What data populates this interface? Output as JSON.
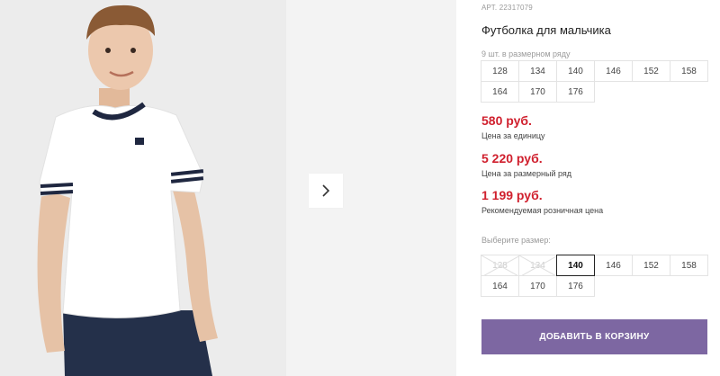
{
  "gallery": {
    "main_photo_icon": "boy-in-white-tshirt-photo",
    "next_icon": "chevron-right-icon"
  },
  "product": {
    "art_label": "АРТ. 22317079",
    "title": "Футболка для мальчика",
    "pack_label": "9 шт. в размерном ряду",
    "pack_sizes": [
      "128",
      "134",
      "140",
      "146",
      "152",
      "158",
      "164",
      "170",
      "176"
    ],
    "prices": [
      {
        "value": "580 руб.",
        "note": "Цена за единицу"
      },
      {
        "value": "5 220 руб.",
        "note": "Цена за размерный ряд"
      },
      {
        "value": "1 199 руб.",
        "note": "Рекомендуемая розничная цена"
      }
    ],
    "choose_label": "Выберите размер:",
    "choose_sizes": [
      {
        "label": "128",
        "state": "disabled"
      },
      {
        "label": "134",
        "state": "disabled"
      },
      {
        "label": "140",
        "state": "selected"
      },
      {
        "label": "146",
        "state": "available"
      },
      {
        "label": "152",
        "state": "available"
      },
      {
        "label": "158",
        "state": "available"
      },
      {
        "label": "164",
        "state": "available"
      },
      {
        "label": "170",
        "state": "available"
      },
      {
        "label": "176",
        "state": "available"
      }
    ],
    "cart_button": "ДОБАВИТЬ В КОРЗИНУ"
  },
  "colors": {
    "price": "#d0202e",
    "cart_button": "#7d67a2",
    "selected_border": "#222222"
  }
}
